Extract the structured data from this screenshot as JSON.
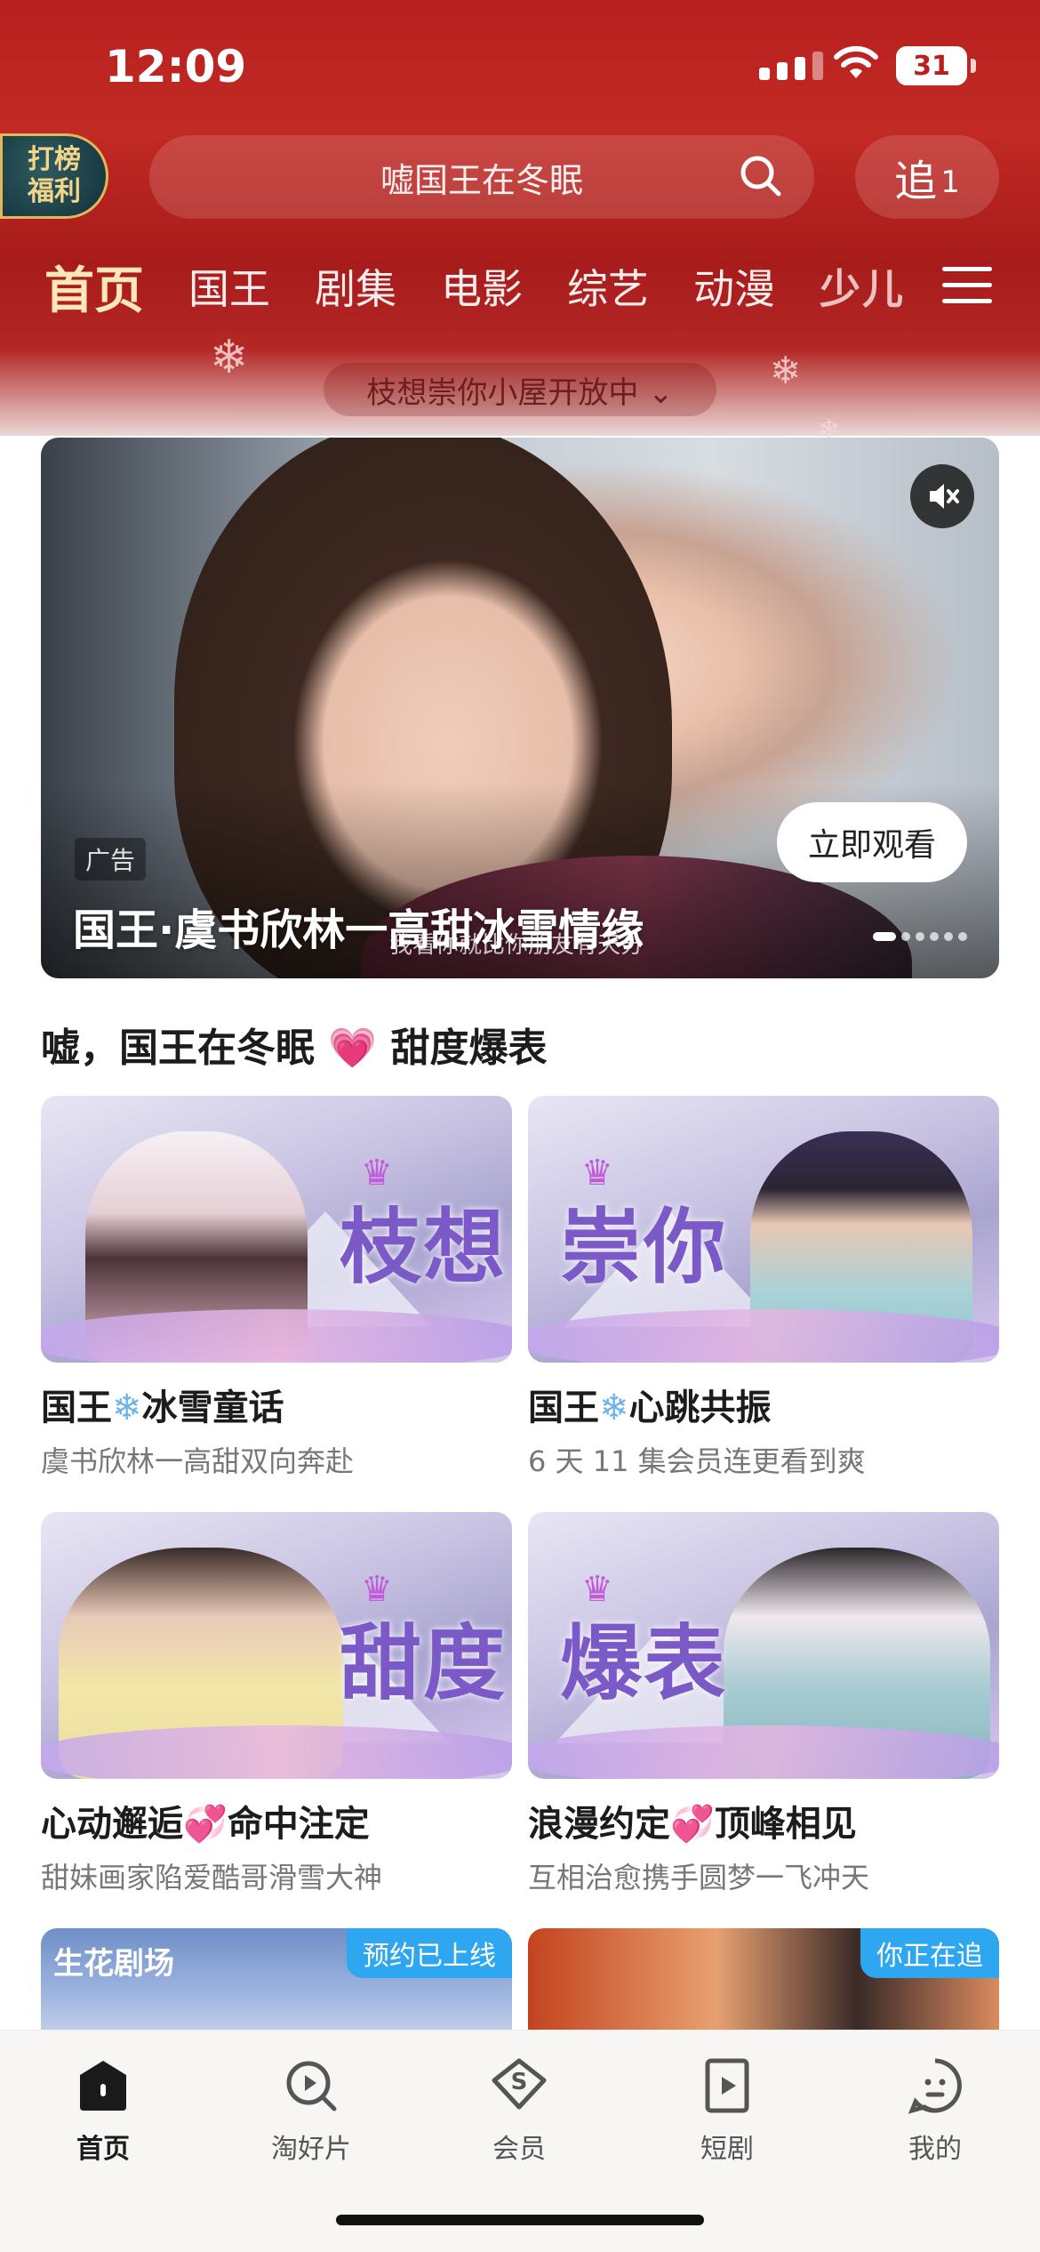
{
  "status_bar": {
    "time": "12:09",
    "battery": "31"
  },
  "header": {
    "rank_badge": "打榜\n福利",
    "search_placeholder": "嘘国王在冬眠",
    "follow_label": "追",
    "follow_count": "1",
    "tabs": [
      "首页",
      "国王",
      "剧集",
      "电影",
      "综艺",
      "动漫",
      "少儿"
    ],
    "active_tab": "首页",
    "notice": "枝想崇你小屋开放中 ⌄"
  },
  "banner": {
    "ad_tag": "广告",
    "title": "国王·虞书欣林一高甜冰雪情缘",
    "subtitle": "我看你就比你朋友有天分",
    "watch_button": "立即观看",
    "page_count": 6,
    "current_page": 1
  },
  "section": {
    "title_left": "嘘，国王在冬眠",
    "title_right": "甜度爆表",
    "cards": [
      {
        "badge_text": "枝想",
        "title_a": "国王",
        "title_b": "冰雪童话",
        "separator": "snow",
        "subtitle": "虞书欣林一高甜双向奔赴"
      },
      {
        "badge_text": "崇你",
        "title_a": "国王",
        "title_b": "心跳共振",
        "separator": "snow",
        "subtitle": "6 天 11 集会员连更看到爽"
      },
      {
        "badge_text": "甜度",
        "title_a": "心动邂逅",
        "title_b": "命中注定",
        "separator": "heart",
        "subtitle": "甜妹画家陷爱酷哥滑雪大神"
      },
      {
        "badge_text": "爆表",
        "title_a": "浪漫约定",
        "title_b": "顶峰相见",
        "separator": "heart",
        "subtitle": "互相治愈携手圆梦一飞冲天"
      }
    ],
    "partial_cards": [
      {
        "logo": "生花剧场",
        "tag": "预约已上线"
      },
      {
        "tag": "你正在追"
      }
    ]
  },
  "bottom_nav": [
    {
      "label": "首页",
      "icon": "home-icon",
      "active": true
    },
    {
      "label": "淘好片",
      "icon": "discover-icon",
      "active": false
    },
    {
      "label": "会员",
      "icon": "vip-icon",
      "active": false
    },
    {
      "label": "短剧",
      "icon": "short-drama-icon",
      "active": false
    },
    {
      "label": "我的",
      "icon": "profile-icon",
      "active": false
    }
  ],
  "colors": {
    "header_red": "#b7201f",
    "tab_active": "#fbe7b7",
    "accent_blue": "#2ea7f0",
    "heart_pink": "#e8368f"
  }
}
